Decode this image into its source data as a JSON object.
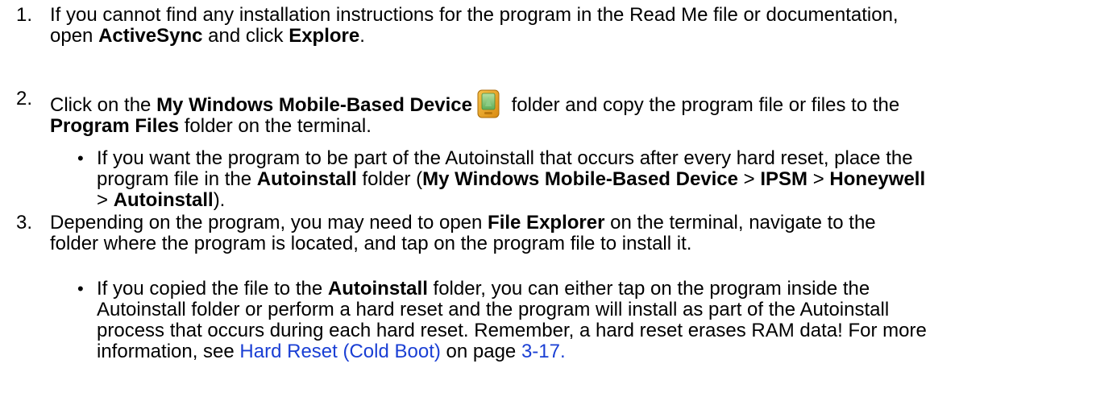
{
  "steps": [
    {
      "number": "1.",
      "parts": {
        "a": "If you cannot find any installation instructions for the program in the Read Me file or documentation,",
        "b": "open ",
        "c": "ActiveSync",
        "d": " and click ",
        "e": "Explore",
        "f": "."
      }
    },
    {
      "number": "2.",
      "parts": {
        "a": "Click on the ",
        "b": "My Windows Mobile-Based Device",
        "c": " folder and copy the program file or files to the",
        "d": "Program Files",
        "e": " folder on the terminal."
      },
      "icon": "mobile-device-icon",
      "bullet": {
        "symbol": "•",
        "a": "If you want the program to be part of the Autoinstall that occurs after every hard reset, place the",
        "b": "program file in the ",
        "c": "Autoinstall",
        "d": " folder (",
        "e": "My Windows Mobile-Based Device",
        "f": " > ",
        "g": "IPSM",
        "h": " > ",
        "i": "Honeywell",
        "j": "> ",
        "k": "Autoinstall",
        "l": ")."
      }
    },
    {
      "number": "3.",
      "parts": {
        "a": "Depending on the program, you may need to open ",
        "b": "File Explorer",
        "c": " on the terminal, navigate to the",
        "d": "folder where the program is located, and tap on the program file to install it."
      },
      "bullet": {
        "symbol": "•",
        "a": "If you copied the file to the ",
        "b": "Autoinstall",
        "c": " folder, you can either tap on the program inside the",
        "d": "Autoinstall folder or perform a hard reset and the program will install as part of the Autoinstall",
        "e": "process that occurs during each hard reset. Remember, a hard reset erases RAM data! For more",
        "f": "information, see ",
        "g": "Hard Reset (Cold Boot)",
        "h": " on page ",
        "i": "3-17."
      }
    }
  ],
  "colors": {
    "link": "#1a3fd4",
    "text": "#000000"
  }
}
